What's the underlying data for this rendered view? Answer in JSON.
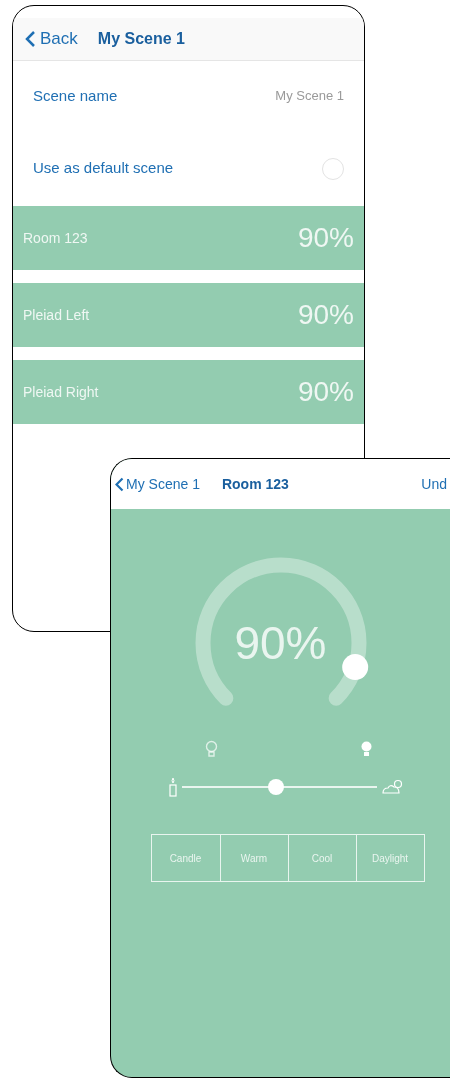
{
  "scene_screen": {
    "nav": {
      "back": "Back",
      "title": "My Scene 1"
    },
    "settings": [
      {
        "kind": "field",
        "label": "Scene name",
        "value": "My Scene 1"
      },
      {
        "kind": "toggle",
        "label": "Use as default scene",
        "checked": false
      }
    ],
    "lights": [
      {
        "name": "Room 123",
        "reading": "90%"
      },
      {
        "name": "Pleiad Left",
        "reading": "90%"
      },
      {
        "name": "Pleiad Right",
        "reading": "90%"
      }
    ]
  },
  "light_screen": {
    "nav": {
      "back": "My Scene 1",
      "title": "Room 123",
      "action": "Und"
    },
    "dial": {
      "level": 0.9,
      "reading": "90%"
    },
    "temperature": {
      "level": 0.48
    },
    "presets": [
      {
        "label": "Candle",
        "selected": false
      },
      {
        "label": "Warm",
        "selected": false
      },
      {
        "label": "Cool",
        "selected": false
      },
      {
        "label": "Daylight",
        "selected": false
      }
    ]
  }
}
